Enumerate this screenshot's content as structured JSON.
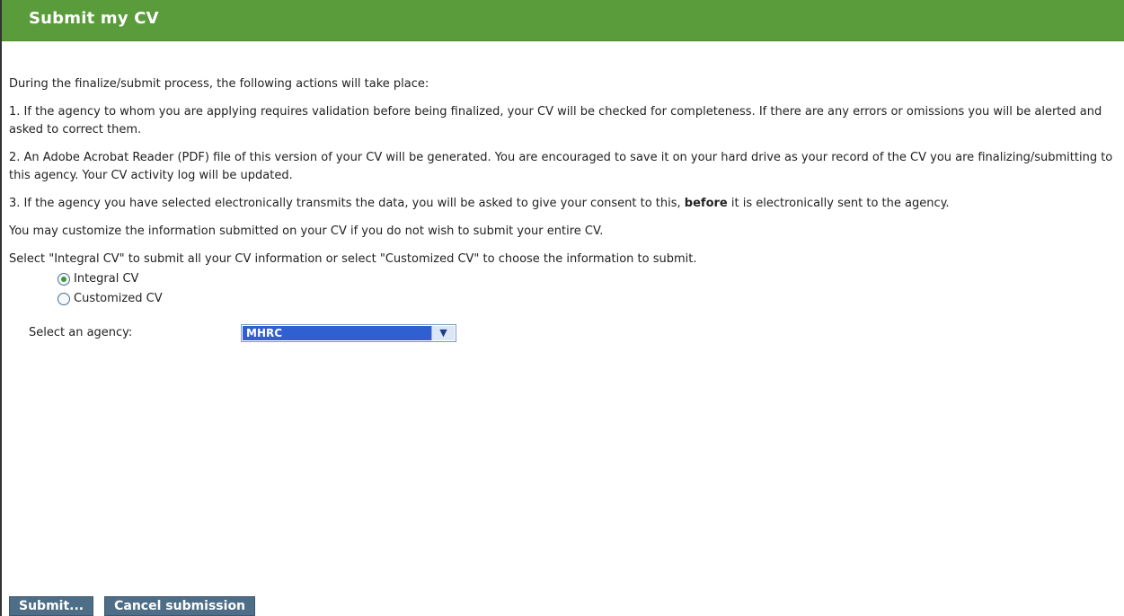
{
  "header": {
    "title": "Submit my CV"
  },
  "intro": "During the finalize/submit process, the following actions will take place:",
  "steps": [
    "1. If the agency to whom you are applying requires validation before being finalized, your CV will be checked for completeness. If there are any errors or omissions you will be alerted and asked to correct them.",
    "2. An Adobe Acrobat Reader (PDF) file of this version of your CV will be generated. You are encouraged to save it on your hard drive as your record of the CV you are finalizing/submitting to this agency. Your CV activity log will be updated.",
    {
      "before_bold": "3. If the agency you have selected electronically transmits the data, you will be asked to give your consent to this, ",
      "bold": "before",
      "after_bold": " it is electronically sent to the agency."
    }
  ],
  "customize_note": "You may customize the information submitted on your CV if you do not wish to submit your entire CV.",
  "select_instructions": "Select \"Integral CV\" to submit all your CV information or select \"Customized CV\" to choose the information to submit.",
  "options": [
    {
      "label": "Integral CV",
      "selected": true
    },
    {
      "label": "Customized CV",
      "selected": false
    }
  ],
  "agency": {
    "label": "Select an agency:",
    "value": "MHRC"
  },
  "buttons": {
    "submit": "Submit...",
    "cancel": "Cancel submission"
  },
  "colors": {
    "header": "#5a9c3c",
    "button": "#4e6d87",
    "selection": "#2f5fd0"
  }
}
